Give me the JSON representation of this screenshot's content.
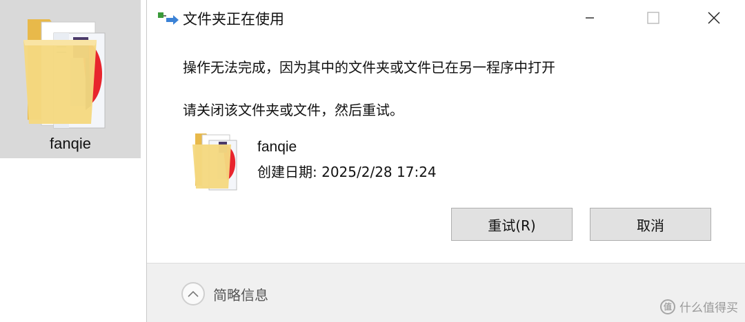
{
  "desktop": {
    "folder_label": "fanqie",
    "folder_icon": "folder-icon"
  },
  "dialog": {
    "title": "文件夹正在使用",
    "title_icon": "folder-in-use-icon",
    "window_controls": {
      "minimize_icon": "minimize-icon",
      "maximize_icon": "maximize-icon",
      "close_icon": "close-icon"
    },
    "message": "操作无法完成，因为其中的文件夹或文件已在另一程序中打开",
    "hint": "请关闭该文件夹或文件，然后重试。",
    "file": {
      "name": "fanqie",
      "created": "创建日期: 2025/2/28 17:24",
      "icon": "folder-icon"
    },
    "buttons": {
      "retry": "重试(R)",
      "cancel": "取消"
    },
    "details_toggle": {
      "label": "简略信息",
      "icon": "chevron-up-icon"
    }
  },
  "watermark": {
    "text": "什么值得买",
    "logo_glyph": "值"
  },
  "colors": {
    "desktop_selected_bg": "#d9d9d9",
    "button_bg": "#e1e1e1",
    "footer_bg": "#f0f0f0",
    "folder_yellow": "#f3d57e",
    "accent_red": "#e8252d"
  }
}
